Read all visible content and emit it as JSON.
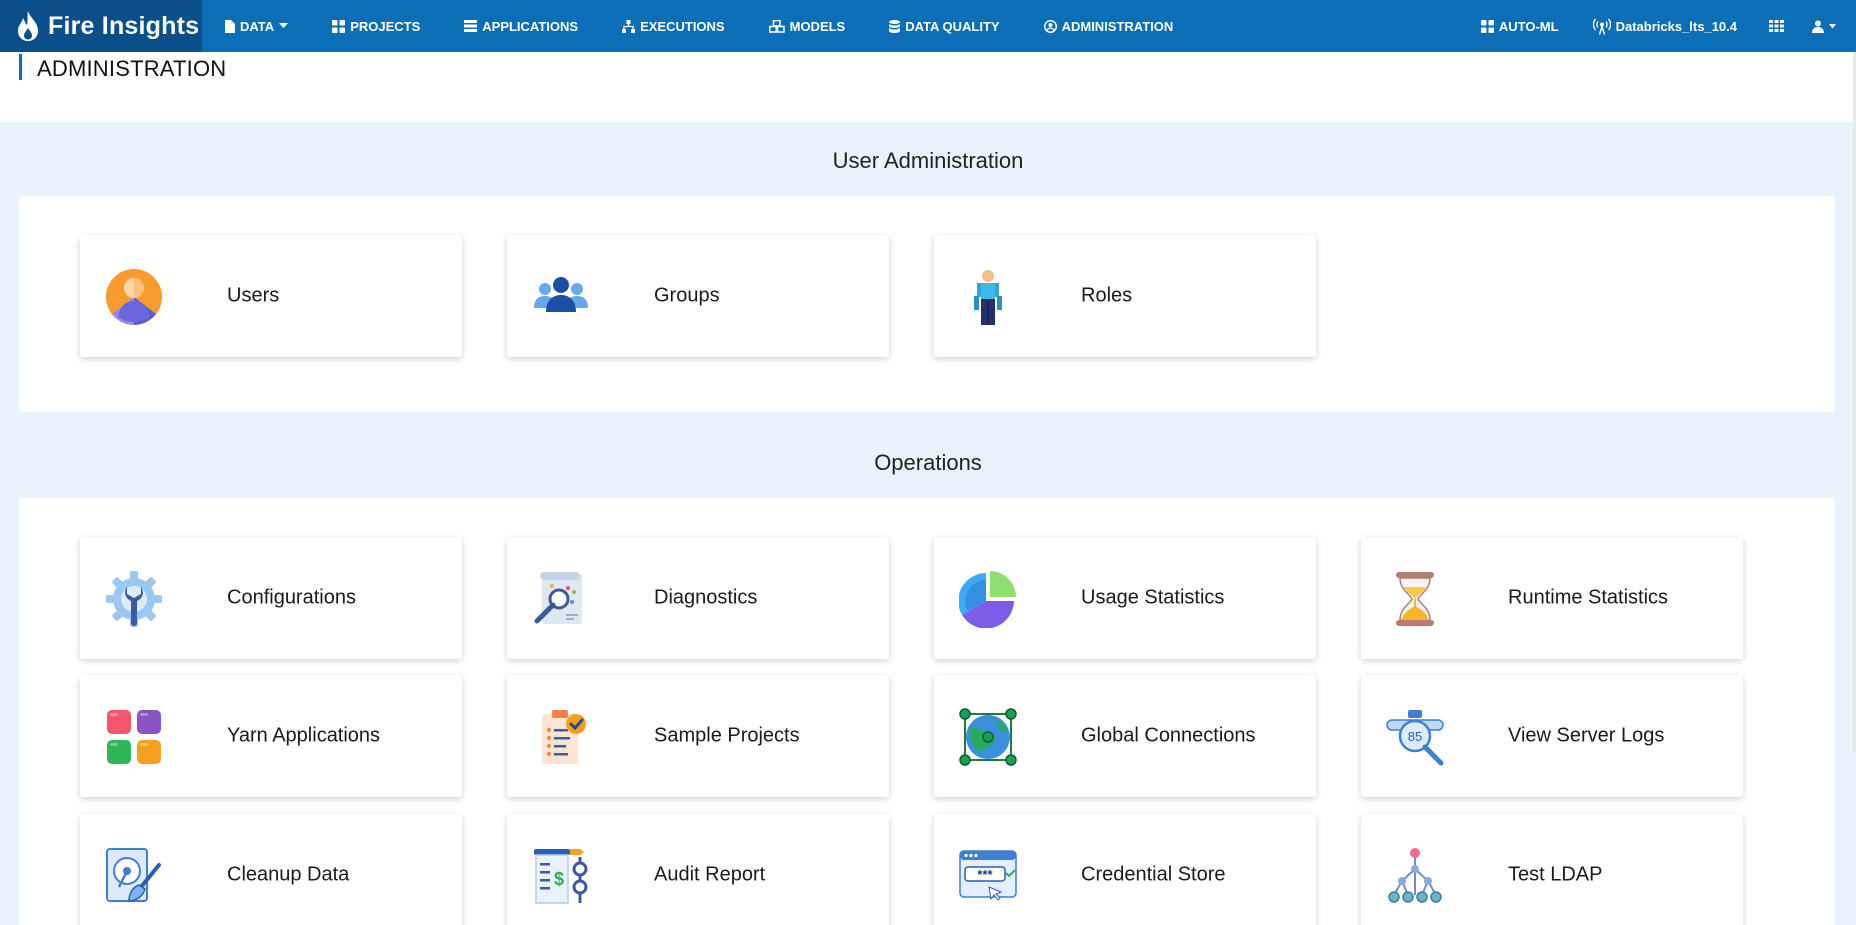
{
  "app": {
    "name": "Fire Insights"
  },
  "nav": {
    "data": "DATA",
    "projects": "PROJECTS",
    "applications": "APPLICATIONS",
    "executions": "EXECUTIONS",
    "models": "MODELS",
    "data_quality": "DATA QUALITY",
    "administration": "ADMINISTRATION",
    "auto_ml": "AUTO-ML",
    "cluster": "Databricks_lts_10.4"
  },
  "page": {
    "title": "ADMINISTRATION"
  },
  "sections": {
    "user_admin": {
      "title": "User Administration",
      "cards": [
        {
          "label": "Users",
          "icon": "users-icon"
        },
        {
          "label": "Groups",
          "icon": "groups-icon"
        },
        {
          "label": "Roles",
          "icon": "roles-icon"
        }
      ]
    },
    "operations": {
      "title": "Operations",
      "cards": [
        {
          "label": "Configurations",
          "icon": "configurations-icon"
        },
        {
          "label": "Diagnostics",
          "icon": "diagnostics-icon"
        },
        {
          "label": "Usage Statistics",
          "icon": "usage-statistics-icon"
        },
        {
          "label": "Runtime Statistics",
          "icon": "hourglass-icon"
        },
        {
          "label": "Yarn Applications",
          "icon": "yarn-applications-icon"
        },
        {
          "label": "Sample Projects",
          "icon": "sample-projects-icon"
        },
        {
          "label": "Global Connections",
          "icon": "global-connections-icon"
        },
        {
          "label": "View Server Logs",
          "icon": "server-logs-icon"
        },
        {
          "label": "Cleanup Data",
          "icon": "cleanup-data-icon"
        },
        {
          "label": "Audit Report",
          "icon": "audit-report-icon"
        },
        {
          "label": "Credential Store",
          "icon": "credential-store-icon"
        },
        {
          "label": "Test LDAP",
          "icon": "ldap-icon"
        }
      ]
    }
  },
  "icon_badges": {
    "server_logs": "85",
    "credential": "***"
  },
  "colors": {
    "nav_bg": "#0d6eb8",
    "brand_bg": "#0a4f8a",
    "page_bg": "#eaf3fd"
  }
}
